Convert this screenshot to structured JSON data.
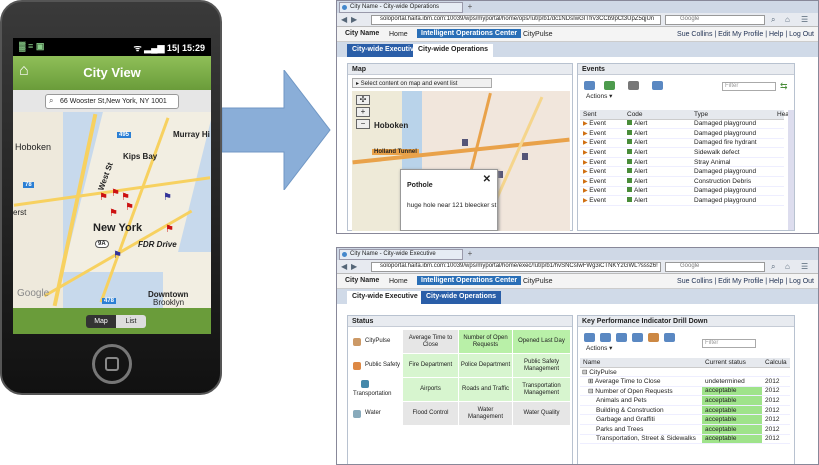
{
  "phone": {
    "status_left": "▓ ≡ ▣",
    "status_right": "ᯤ ▂▄▆ 15| 15:29",
    "home_icon": "home-icon",
    "title": "City View",
    "address": "66 Wooster St,New York, NY 1001",
    "map_labels": [
      "Hoboken",
      "Murray Hi",
      "Kips Bay",
      "New York",
      "FDR Drive",
      "Downtown",
      "Brooklyn",
      "West St",
      "9A",
      "78",
      "495",
      "478",
      "Google",
      "erst"
    ],
    "segment": {
      "map": "Map",
      "list": "List"
    }
  },
  "browser_events": {
    "tab_title": "City Name - City-wide Operations",
    "tab_plus": "+",
    "url": "soloportal.haifa.ibm.com:10039/wps/myportal/home/ops/!ut/p/b1/dc1NDsIwGITfrv3CCb9pCt3UpZ5qjUn",
    "google_search": "Google",
    "city_name": "City Name",
    "nav_home": "Home",
    "nav_ioc": "Intelligent Operations Center",
    "nav_citypulse": "CityPulse",
    "user_links": "Sue Collins  |  Edit My Profile  |  Help  |  Log Out",
    "tabs": [
      "City-wide Executive",
      "City-wide Operations"
    ],
    "map_panel": {
      "title": "Map",
      "select_label": "▸ Select content on map and event list",
      "hoboken": "Hoboken",
      "holland": "Holland Tunnel",
      "popup_title": "Pothole",
      "popup_body": "huge hole near 121 bleecker st",
      "close": "✕"
    },
    "events_panel": {
      "title": "Events",
      "actions": "Actions ▾",
      "filter_placeholder": "Filter",
      "headers": [
        "Sent",
        "Code",
        "Type",
        "Hea"
      ],
      "rows": [
        [
          "Event",
          "Alert",
          "Damaged playground"
        ],
        [
          "Event",
          "Alert",
          "Damaged playground"
        ],
        [
          "Event",
          "Alert",
          "Damaged fire hydrant"
        ],
        [
          "Event",
          "Alert",
          "Sidewalk defect"
        ],
        [
          "Event",
          "Alert",
          "Stray Animal"
        ],
        [
          "Event",
          "Alert",
          "Damaged playground"
        ],
        [
          "Event",
          "Alert",
          "Construction Debris"
        ],
        [
          "Event",
          "Alert",
          "Damaged playground"
        ],
        [
          "Event",
          "Alert",
          "Damaged playground"
        ]
      ]
    }
  },
  "browser_exec": {
    "tab_title": "City Name - City-wide Executive",
    "tab_plus": "+",
    "url": "soloportal.haifa.ibm.com:10039/wps/myportal/home/exec/!ut/p/b1/hvSNCsIwFWg3iCTNKY2GWL?sssz6!",
    "google_search": "Google",
    "city_name": "City Name",
    "nav_home": "Home",
    "nav_ioc": "Intelligent Operations Center",
    "nav_citypulse": "CityPulse",
    "user_links": "Sue Collins  |  Edit My Profile  |  Help  |  Log Out",
    "tabs": [
      "City-wide Executive",
      "City-wide Operations"
    ],
    "status_panel": {
      "title": "Status",
      "rows": [
        [
          "CityPulse",
          "Average Time to Close",
          "Number of Open Requests",
          "Opened Last Day"
        ],
        [
          "Public Safety",
          "Fire Department",
          "Police Department",
          "Public Safety Management"
        ],
        [
          "Transportation",
          "Airports",
          "Roads and Traffic",
          "Transportation Management"
        ],
        [
          "Water",
          "Flood Control",
          "Water Management",
          "Water Quality"
        ]
      ]
    },
    "kpi_panel": {
      "title": "Key Performance Indicator Drill Down",
      "actions": "Actions ▾",
      "filter_placeholder": "Filter",
      "headers": [
        "Name",
        "Current status",
        "Calcula"
      ],
      "rows": [
        [
          "⊟ CityPulse",
          "",
          ""
        ],
        [
          "⊞ Average Time to Close",
          "undetermined",
          "2012"
        ],
        [
          "⊟ Number of Open Requests",
          "acceptable",
          "2012"
        ],
        [
          "Animals and Pets",
          "acceptable",
          "2012"
        ],
        [
          "Building & Construction",
          "acceptable",
          "2012"
        ],
        [
          "Garbage and Graffiti",
          "acceptable",
          "2012"
        ],
        [
          "Parks and Trees",
          "acceptable",
          "2012"
        ],
        [
          "Transportation, Street & Sidewalks",
          "acceptable",
          "2012"
        ]
      ]
    }
  }
}
